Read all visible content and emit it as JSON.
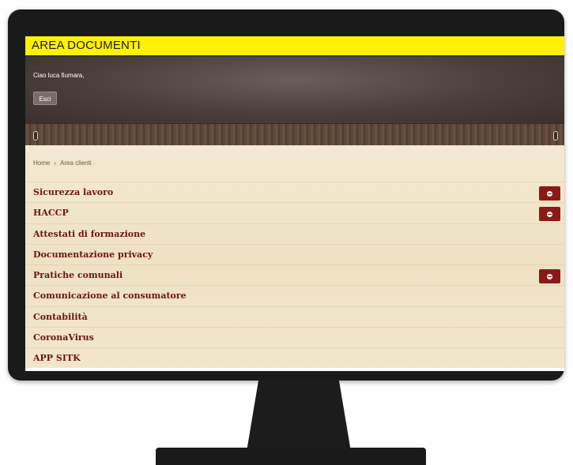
{
  "header": {
    "title": "AREA DOCUMENTI",
    "greeting": "Ciao luca fiumara,",
    "logout_label": "Esci"
  },
  "breadcrumb": {
    "home": "Home",
    "separator": "›",
    "current": "Area clienti"
  },
  "menu": {
    "items": [
      {
        "label": "Sicurezza lavoro",
        "expandable": true
      },
      {
        "label": "HACCP",
        "expandable": true
      },
      {
        "label": "Attestati di formazione",
        "expandable": false
      },
      {
        "label": "Documentazione privacy",
        "expandable": false
      },
      {
        "label": "Pratiche comunali",
        "expandable": true
      },
      {
        "label": "Comunicazione al consumatore",
        "expandable": false
      },
      {
        "label": "Contabilità",
        "expandable": false
      },
      {
        "label": "CoronaVirus",
        "expandable": false
      },
      {
        "label": "APP SITK",
        "expandable": false
      }
    ],
    "expand_icon": "minus-circle-icon"
  },
  "colors": {
    "title_bar": "#fff200",
    "header_bg": "#4a3f3b",
    "menu_text": "#6b1412",
    "expand_button": "#8b1a16",
    "content_bg": "#efe3c6"
  }
}
